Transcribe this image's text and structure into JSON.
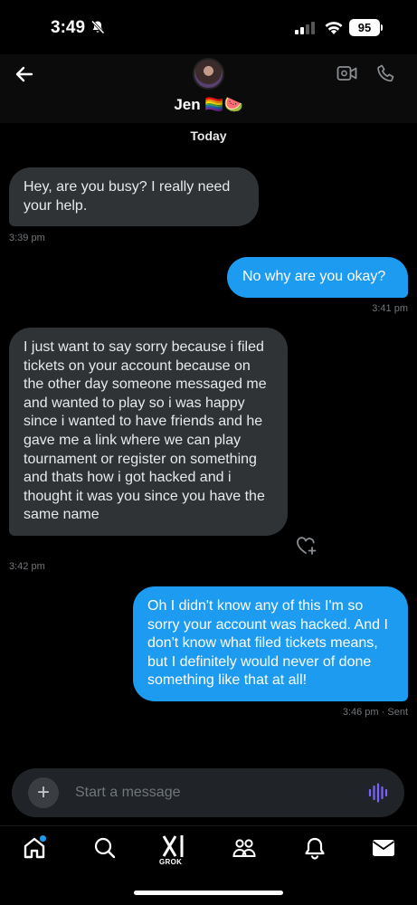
{
  "status_bar": {
    "time": "3:49",
    "battery": "95"
  },
  "header": {
    "name": "Jen 🏳️‍🌈🍉"
  },
  "day_label": "Today",
  "messages": [
    {
      "direction": "in",
      "text": "Hey, are you busy? I really need your help.",
      "time": "3:39 pm"
    },
    {
      "direction": "out",
      "text": "No why are you okay?",
      "time": "3:41 pm"
    },
    {
      "direction": "in",
      "text": "I just want to say sorry because i filed tickets on your account because on the other day someone messaged me and wanted to play so i was happy since i wanted to have friends and he gave me a link where we can play tournament or register on something and thats how i got hacked and i thought it was you since you have the same name",
      "time": "3:42 pm"
    },
    {
      "direction": "out",
      "text": "Oh I didn't know any of this I'm so sorry your account was hacked. And I don't know what filed tickets means, but I definitely would never of done something like that at all!",
      "time": "3:46 pm · Sent"
    }
  ],
  "composer": {
    "placeholder": "Start a message"
  },
  "tabbar": {
    "grok_label": "GROK"
  },
  "colors": {
    "accent": "#1d9bf0",
    "incoming_bubble": "#2f3336",
    "voice_icon": "#7b61ff"
  }
}
